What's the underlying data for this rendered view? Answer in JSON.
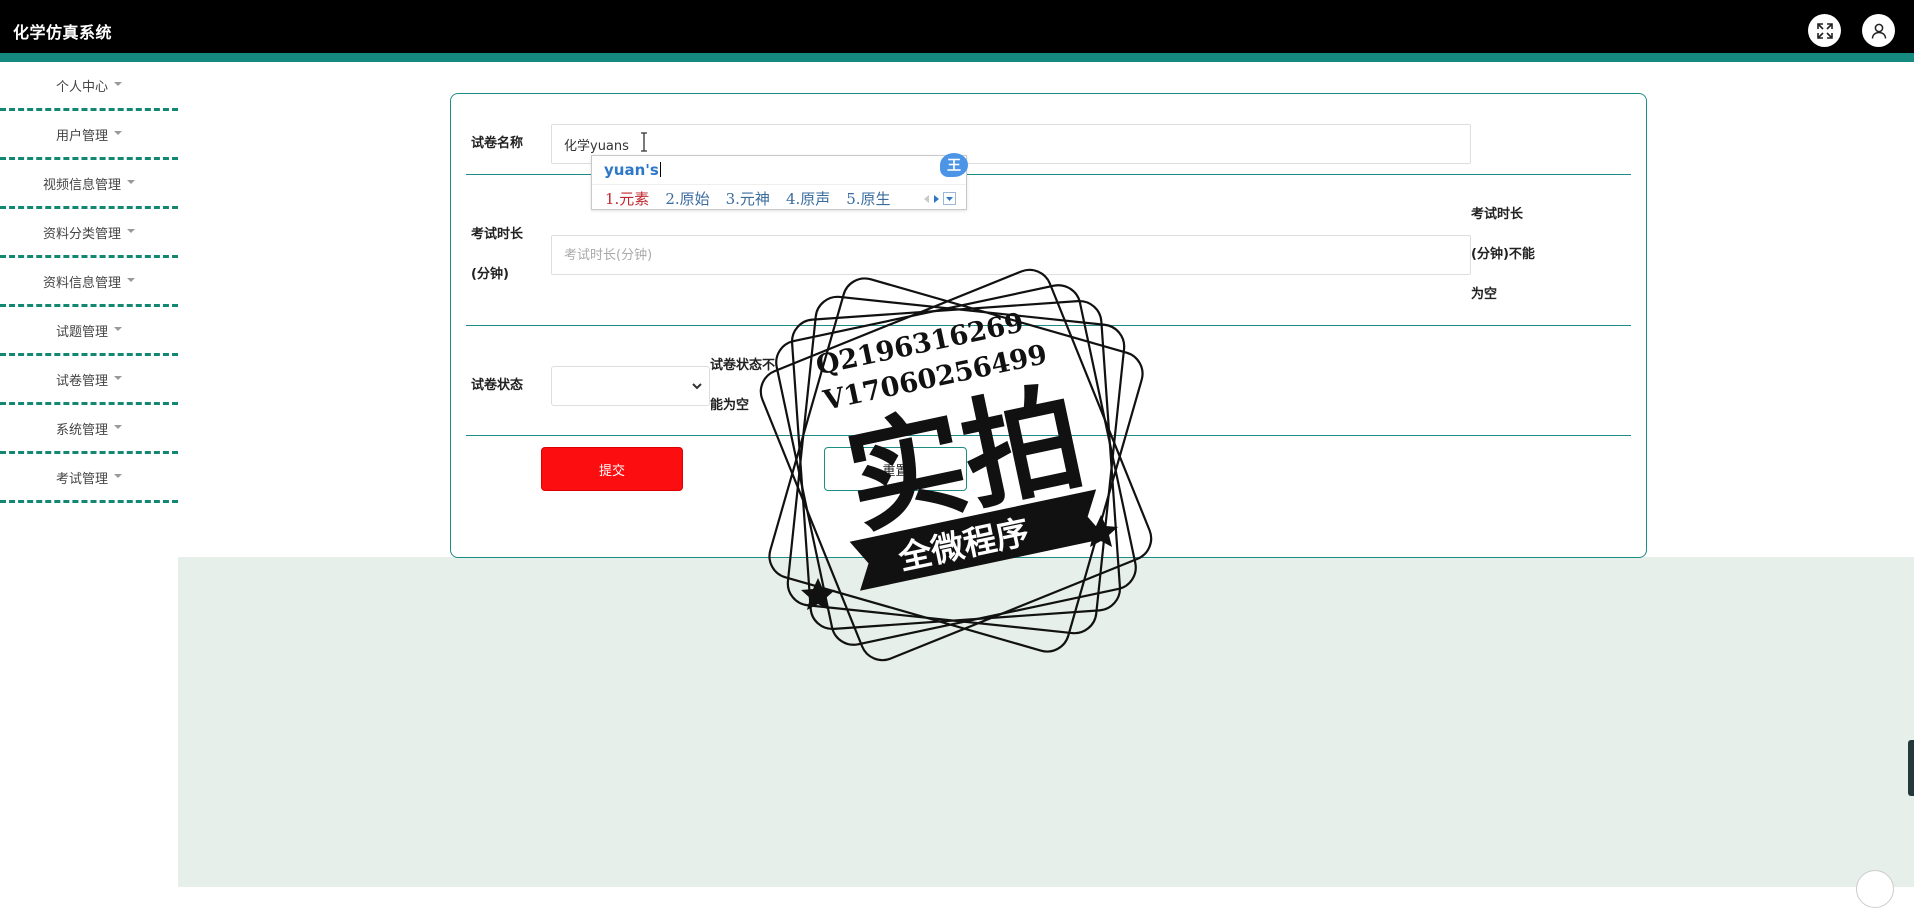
{
  "app": {
    "title": "化学仿真系统"
  },
  "sidebar": {
    "items": [
      {
        "label": "个人中心"
      },
      {
        "label": "用户管理"
      },
      {
        "label": "视频信息管理"
      },
      {
        "label": "资料分类管理"
      },
      {
        "label": "资料信息管理"
      },
      {
        "label": "试题管理"
      },
      {
        "label": "试卷管理"
      },
      {
        "label": "系统管理"
      },
      {
        "label": "考试管理"
      }
    ]
  },
  "form": {
    "name_label": "试卷名称",
    "name_value": "化学yuans",
    "duration_label_line1": "考试时长",
    "duration_label_line2": "(分钟)",
    "duration_placeholder": "考试时长(分钟)",
    "duration_error_line1": "考试时长",
    "duration_error_line2": "(分钟)不能",
    "duration_error_line3": "为空",
    "status_label": "试卷状态",
    "status_value": "",
    "status_error_line1": "试卷状态不",
    "status_error_line2": "能为空",
    "submit_label": "提交",
    "reset_label": "重置"
  },
  "ime": {
    "composition": "yuan's",
    "candidates": [
      "1.元素",
      "2.原始",
      "3.元神",
      "4.原声",
      "5.原生"
    ],
    "logo": "王"
  },
  "watermark": {
    "line1": "Q2196316269",
    "line2": "V17060256499",
    "main": "实拍",
    "banner": "全微程序"
  },
  "colors": {
    "header_bg": "#000000",
    "accent_teal": "#158a80",
    "submit_red": "#fb0d10",
    "content_bg": "#e6efea"
  }
}
